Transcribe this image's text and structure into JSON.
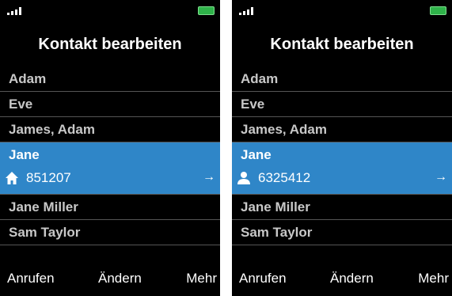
{
  "colors": {
    "accent": "#2f86c8",
    "battery": "#2fb34a",
    "background": "#000000"
  },
  "screens": [
    {
      "title": "Kontakt bearbeiten",
      "contacts": [
        "Adam",
        "Eve",
        "James, Adam"
      ],
      "selected": {
        "name": "Jane",
        "number": "851207",
        "icon": "home-icon",
        "arrow": "→"
      },
      "contacts_after": [
        "Jane Miller",
        "Sam Taylor"
      ],
      "softkeys": {
        "left": "Anrufen",
        "middle": "Ändern",
        "right": "Mehr"
      }
    },
    {
      "title": "Kontakt bearbeiten",
      "contacts": [
        "Adam",
        "Eve",
        "James, Adam"
      ],
      "selected": {
        "name": "Jane",
        "number": "6325412",
        "icon": "person-icon",
        "arrow": "→"
      },
      "contacts_after": [
        "Jane Miller",
        "Sam Taylor"
      ],
      "softkeys": {
        "left": "Anrufen",
        "middle": "Ändern",
        "right": "Mehr"
      }
    }
  ]
}
